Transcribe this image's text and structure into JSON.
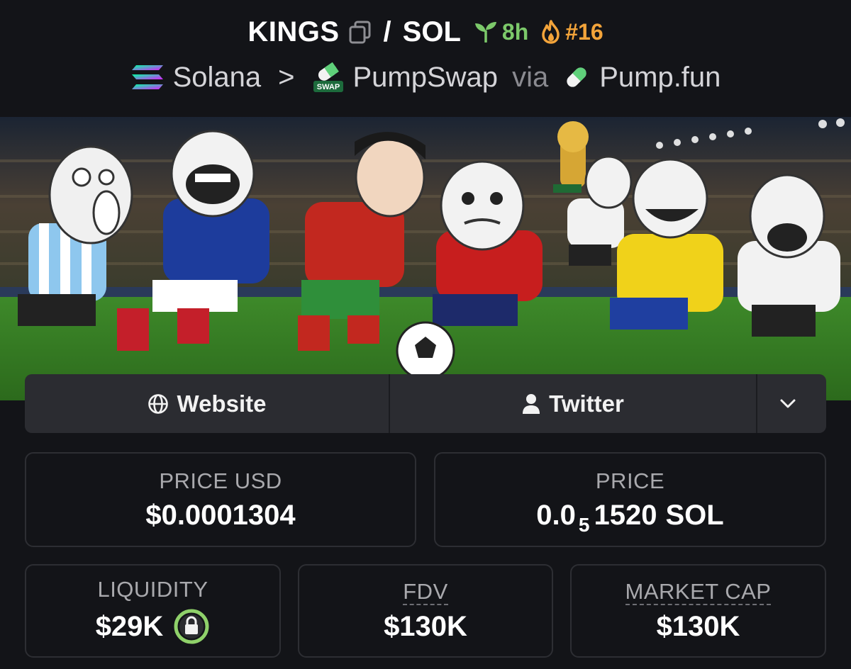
{
  "pair": {
    "base": "KINGS",
    "slash": "/",
    "quote": "SOL",
    "age": "8h",
    "rank": "#16"
  },
  "route": {
    "chain": "Solana",
    "separator": ">",
    "dex": "PumpSwap",
    "dex_icon_text": "SWAP",
    "via": "via",
    "launchpad": "Pump.fun"
  },
  "icons": {
    "copy": "copy-icon",
    "age": "seedling-icon",
    "rank": "flame-icon",
    "chain": "solana-icon",
    "dex": "pumpswap-icon",
    "launchpad": "pill-icon",
    "website": "globe-icon",
    "twitter": "user-icon",
    "more": "chevron-down-icon",
    "liquidity_lock": "lock-icon"
  },
  "links": {
    "website": "Website",
    "twitter": "Twitter"
  },
  "stats": {
    "price_usd": {
      "label": "PRICE USD",
      "value": "$0.0001304"
    },
    "price_native": {
      "label": "PRICE",
      "prefix": "0.0",
      "zeros": "5",
      "digits": "1520",
      "unit": "SOL"
    },
    "liquidity": {
      "label": "LIQUIDITY",
      "value": "$29K"
    },
    "fdv": {
      "label": "FDV",
      "value": "$130K"
    },
    "market_cap": {
      "label": "MARKET CAP",
      "value": "$130K"
    }
  },
  "colors": {
    "background": "#131418",
    "age_green": "#7cc96a",
    "rank_orange": "#f3a43a",
    "lock_green": "#8fd16a",
    "card_border": "#2d2e33",
    "bar_bg": "#2b2c31"
  }
}
